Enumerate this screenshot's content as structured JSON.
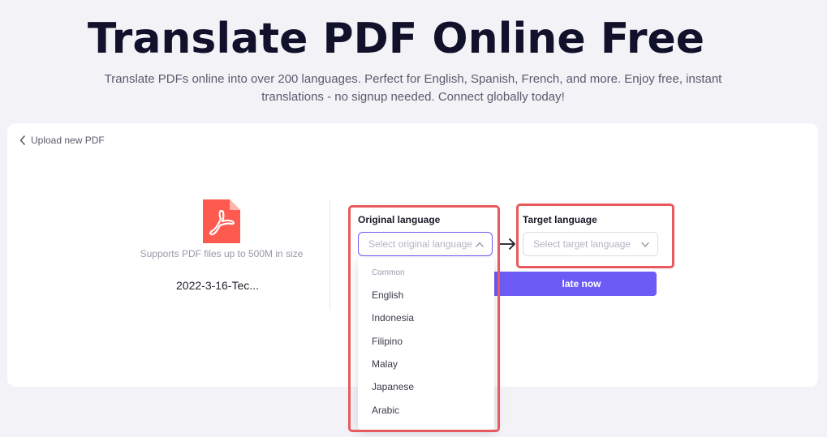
{
  "hero": {
    "title": "Translate PDF Online Free",
    "subtitle_line1": "Translate PDFs online into over 200 languages. Perfect for English, Spanish, French, and more. Enjoy free, instant",
    "subtitle_line2": "translations - no signup needed. Connect globally today!"
  },
  "upload": {
    "back_label": "Upload new PDF",
    "file_icon": "pdf-file-icon",
    "supports_text": "Supports PDF files up to 500M in size",
    "file_name": "2022-3-16-Tec..."
  },
  "original_language": {
    "label": "Original language",
    "placeholder": "Select original language"
  },
  "target_language": {
    "label": "Target language",
    "placeholder": "Select target language"
  },
  "translate_button": {
    "label": "late now"
  },
  "dropdown": {
    "group_header": "Common",
    "options": [
      "English",
      "Indonesia",
      "Filipino",
      "Malay",
      "Japanese",
      "Arabic"
    ]
  },
  "colors": {
    "accent": "#6c5cf5",
    "highlight": "#e85a5e",
    "pdf_icon": "#ff5a4f"
  }
}
